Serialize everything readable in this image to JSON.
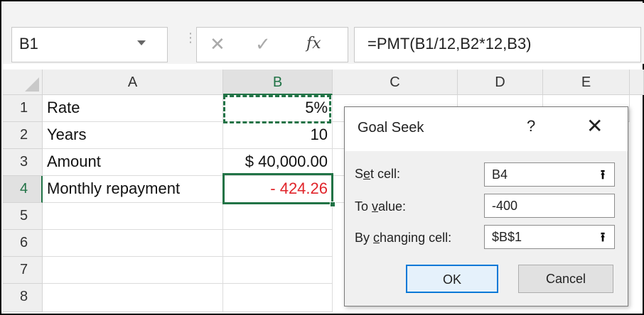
{
  "formula_bar": {
    "name_box": "B1",
    "cancel_icon": "✕",
    "enter_icon": "✓",
    "fx_icon": "fx",
    "formula": "=PMT(B1/12,B2*12,B3)"
  },
  "grid": {
    "columns": [
      "A",
      "B",
      "C",
      "D",
      "E"
    ],
    "rows": [
      "1",
      "2",
      "3",
      "4",
      "5",
      "6",
      "7",
      "8"
    ],
    "cells": {
      "A1": "Rate",
      "B1": "5%",
      "A2": "Years",
      "B2": "10",
      "A3": "Amount",
      "B3": "$ 40,000.00",
      "A4": "Monthly repayment",
      "B4": "- 424.26"
    }
  },
  "goal_seek": {
    "title": "Goal Seek",
    "help": "?",
    "close": "✕",
    "set_cell_label_pre": "S",
    "set_cell_label_u": "e",
    "set_cell_label_post": "t cell:",
    "set_cell_value": "B4",
    "to_value_label_pre": "To ",
    "to_value_label_u": "v",
    "to_value_label_post": "alue:",
    "to_value_value": "-400",
    "by_changing_label_pre": "By ",
    "by_changing_label_u": "c",
    "by_changing_label_post": "hanging cell:",
    "by_changing_value": "$B$1",
    "picker_icon": "⭱",
    "ok": "OK",
    "cancel": "Cancel"
  },
  "colors": {
    "excel_green": "#217346",
    "negative_red": "#e0242a",
    "dialog_accent": "#0078d7"
  }
}
